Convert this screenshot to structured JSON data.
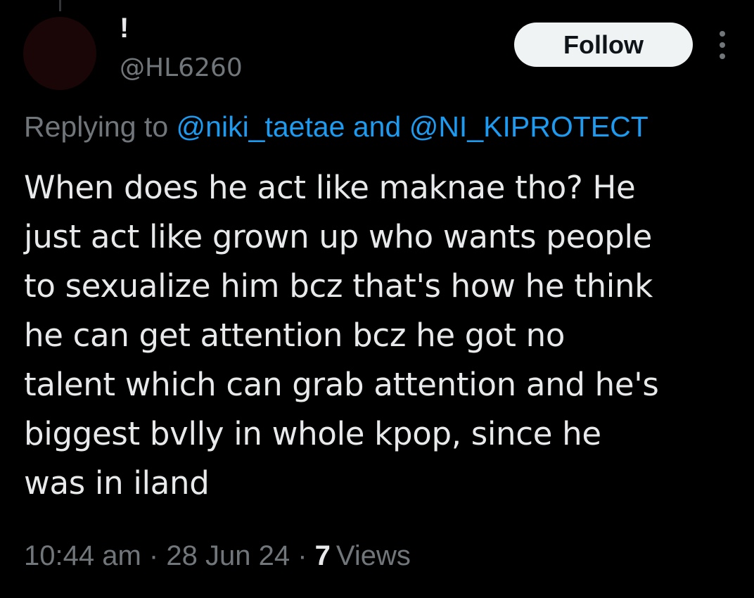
{
  "author": {
    "display_name": "!",
    "handle": "@HL6260"
  },
  "follow_button": {
    "label": "Follow"
  },
  "more_menu": {
    "icon": "more-vertical-icon"
  },
  "reply_context": {
    "prefix": "Replying to",
    "mention_1": "@niki_taetae",
    "joiner": "and",
    "mention_2": "@NI_KIPROTECT"
  },
  "tweet": {
    "lines": [
      "When does he act like maknae tho? He",
      "just act like grown up who wants people",
      "to sexualize him bcz that's how he think",
      "he can get attention bcz he got no",
      "talent which can grab attention and he's",
      "biggest bvlly in whole kpop, since he",
      "was in iland"
    ]
  },
  "meta": {
    "time": "10:44 am",
    "separator": "·",
    "date": "28 Jun 24",
    "views_count": "7",
    "views_label": "Views"
  },
  "colors": {
    "background": "#000000",
    "text_primary": "#e7e9ea",
    "text_secondary": "#71767b",
    "link": "#1d9bf0",
    "follow_button_bg": "#eff3f4"
  }
}
